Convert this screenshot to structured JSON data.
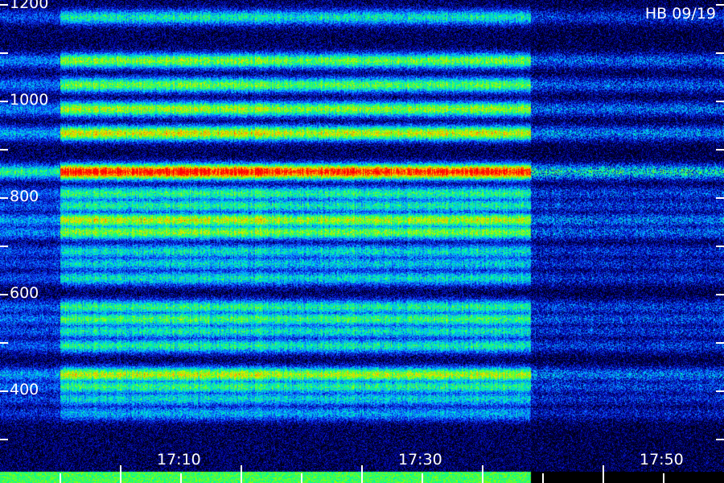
{
  "chart_data": {
    "type": "heatmap",
    "title": "",
    "xlabel": "",
    "ylabel": "",
    "annotation": "HB 09/19",
    "y_ticks_labeled": [
      1200,
      1000,
      800,
      600,
      400
    ],
    "y_ticks_all": [
      1200,
      1100,
      1000,
      900,
      800,
      700,
      600,
      500,
      400,
      300
    ],
    "ylim": [
      250,
      1200
    ],
    "x_ticks_labeled": [
      "17:10",
      "17:30",
      "17:50"
    ],
    "x_ticks_minor_minutes": [
      0,
      5,
      10,
      15,
      20,
      25,
      30,
      35,
      40,
      45,
      50,
      55
    ],
    "x_start": "17:05",
    "x_end": "17:55",
    "xlim": [
      "17:00",
      "17:59"
    ],
    "colormap": [
      "#000010",
      "#0000a0",
      "#1040ff",
      "#00c8ff",
      "#00ff90",
      "#90ff00",
      "#ffe000",
      "#ff6000",
      "#ff0000"
    ],
    "bands": [
      {
        "freq": 1175,
        "strength": 0.4
      },
      {
        "freq": 1085,
        "strength": 0.55
      },
      {
        "freq": 1035,
        "strength": 0.52
      },
      {
        "freq": 985,
        "strength": 0.58
      },
      {
        "freq": 935,
        "strength": 0.65
      },
      {
        "freq": 855,
        "strength": 0.95
      },
      {
        "freq": 810,
        "strength": 0.45
      },
      {
        "freq": 785,
        "strength": 0.42
      },
      {
        "freq": 755,
        "strength": 0.62
      },
      {
        "freq": 730,
        "strength": 0.55
      },
      {
        "freq": 690,
        "strength": 0.38
      },
      {
        "freq": 665,
        "strength": 0.35
      },
      {
        "freq": 635,
        "strength": 0.38
      },
      {
        "freq": 575,
        "strength": 0.44
      },
      {
        "freq": 550,
        "strength": 0.48
      },
      {
        "freq": 525,
        "strength": 0.4
      },
      {
        "freq": 495,
        "strength": 0.42
      },
      {
        "freq": 435,
        "strength": 0.62
      },
      {
        "freq": 410,
        "strength": 0.45
      },
      {
        "freq": 385,
        "strength": 0.36
      },
      {
        "freq": 355,
        "strength": 0.3
      }
    ],
    "segments": [
      {
        "start": "17:00",
        "end": "17:17",
        "level": 1.0
      },
      {
        "start": "17:17",
        "end": "17:39",
        "level": 0.96
      },
      {
        "start": "17:39",
        "end": "17:59",
        "level": 0.45
      }
    ]
  }
}
